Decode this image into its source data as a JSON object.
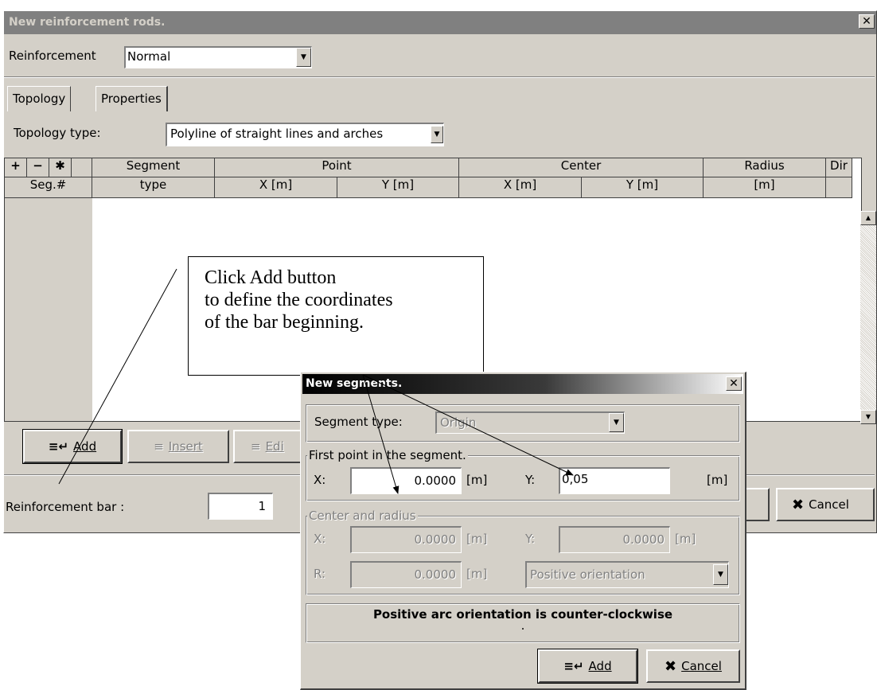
{
  "main": {
    "title": "New reinforcement rods.",
    "close_glyph": "✕",
    "reinforcement_label": "Reinforcement",
    "reinforcement_value": "Normal",
    "tabs": [
      {
        "label": "Topology"
      },
      {
        "label": "Properties"
      }
    ],
    "topology_type_label": "Topology type:",
    "topology_type_value": "Polyline of straight lines and arches",
    "grid": {
      "toolbar_icons": [
        "+",
        "−",
        "✱"
      ],
      "seg_num_header": "Seg.#",
      "headers_top": [
        "Segment",
        "Point",
        "Center",
        "Radius",
        "Dir"
      ],
      "headers_bottom": [
        "type",
        "X [m]",
        "Y [m]",
        "X [m]",
        "Y [m]",
        "[m]"
      ]
    },
    "buttons": {
      "add": "Add",
      "insert": "Insert",
      "edit": "Edi",
      "cancel": "Cancel"
    },
    "reinforcement_bar_label": "Reinforcement bar :",
    "reinforcement_bar_value": "1"
  },
  "callout": {
    "lines": [
      "Click Add button",
      "to define the coordinates",
      "of the bar beginning."
    ]
  },
  "sub": {
    "title": "New segments.",
    "close_glyph": "✕",
    "segment_type_label": "Segment type:",
    "segment_type_value": "Origin",
    "first_point_title": "First point in the segment.",
    "x_label": "X:",
    "x_value": "0.0000",
    "y_label": "Y:",
    "y_value": "0,05",
    "unit": "[m]",
    "center_title": "Center and radius",
    "cx_label": "X:",
    "cx_value": "0.0000",
    "cy_label": "Y:",
    "cy_value": "0.0000",
    "r_label": "R:",
    "r_value": "0.0000",
    "orientation_value": "Positive orientation",
    "info_text": "Positive arc orientation is counter-clockwise",
    "info_dot": ".",
    "add_label": "Add",
    "cancel_label": "Cancel"
  },
  "icons": {
    "add": "add-icon",
    "cancel": "cancel-x-icon",
    "dropdown": "dropdown-arrow-icon"
  },
  "colors": {
    "dialog_bg": "#d4d0c8",
    "inactive_title": "#808080",
    "active_title": "#000000",
    "cancel_x": "#000000"
  }
}
